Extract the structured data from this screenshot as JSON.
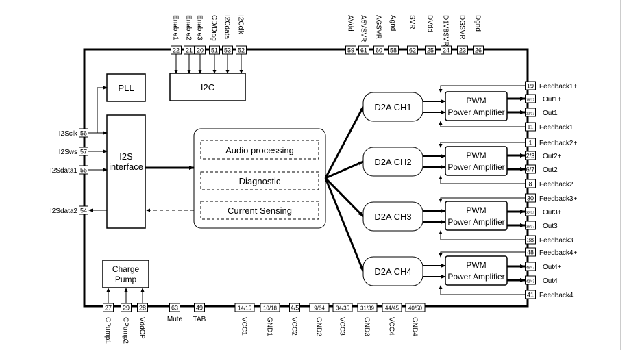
{
  "blocks": {
    "i2c": "I2C",
    "pll": "PLL",
    "i2s": [
      "I2S",
      "interface"
    ],
    "charge_pump": [
      "Charge",
      "Pump"
    ],
    "dsp": [
      "Audio processing",
      "Diagnostic",
      "Current Sensing"
    ],
    "d2a": [
      "D2A CH1",
      "D2A CH2",
      "D2A CH3",
      "D2A CH4"
    ],
    "pwm": [
      "PWM",
      "Power Amplifier"
    ]
  },
  "top_pins": [
    {
      "num": "22",
      "label": "Enable1"
    },
    {
      "num": "21",
      "label": "Enable2"
    },
    {
      "num": "20",
      "label": "Enable3"
    },
    {
      "num": "51",
      "label": "CD/Diag"
    },
    {
      "num": "53",
      "label": "I2Cdata"
    },
    {
      "num": "52",
      "label": "I2Cclk"
    },
    {
      "num": "59",
      "label": "AVdd"
    },
    {
      "num": "61",
      "label": "A5VSVR"
    },
    {
      "num": "60",
      "label": "AGSVR"
    },
    {
      "num": "58",
      "label": "Agnd"
    },
    {
      "num": "62",
      "label": "SVR"
    },
    {
      "num": "25",
      "label": "DVdd"
    },
    {
      "num": "24",
      "label": "D1V8SVR"
    },
    {
      "num": "23",
      "label": "DGSVR"
    },
    {
      "num": "26",
      "label": "Dgnd"
    }
  ],
  "left_pins": [
    {
      "num": "56",
      "label": "I2Sclk"
    },
    {
      "num": "57",
      "label": "I2Sws"
    },
    {
      "num": "55",
      "label": "I2Sdata1"
    },
    {
      "num": "54",
      "label": "I2Sdata2"
    }
  ],
  "right_pins": [
    {
      "num": "19",
      "label": "Feedback1+"
    },
    {
      "num": "16/17",
      "label": "Out1+"
    },
    {
      "num": "12/13",
      "label": "Out1"
    },
    {
      "num": "11",
      "label": "Feedback1"
    },
    {
      "num": "1",
      "label": "Feedback2+"
    },
    {
      "num": "2/3",
      "label": "Out2+"
    },
    {
      "num": "6/7",
      "label": "Out2"
    },
    {
      "num": "8",
      "label": "Feedback2"
    },
    {
      "num": "30",
      "label": "Feedback3+"
    },
    {
      "num": "32/33",
      "label": "Out3+"
    },
    {
      "num": "36/37",
      "label": "Out3"
    },
    {
      "num": "38",
      "label": "Feedback3"
    },
    {
      "num": "48",
      "label": "Feedback4+"
    },
    {
      "num": "46/47",
      "label": "Out4+"
    },
    {
      "num": "42/43",
      "label": "Out4"
    },
    {
      "num": "41",
      "label": "Feedback4"
    }
  ],
  "bottom_pins": [
    {
      "num": "27",
      "label": "CPump1",
      "rot": true
    },
    {
      "num": "29",
      "label": "CPump2",
      "rot": true
    },
    {
      "num": "28",
      "label": "VddCP",
      "rot": true
    },
    {
      "num": "63",
      "label": "Mute",
      "rot": false
    },
    {
      "num": "49",
      "label": "TAB",
      "rot": false
    },
    {
      "num": "14/15",
      "label": "VCC1",
      "rot": true
    },
    {
      "num": "10/18",
      "label": "GND1",
      "rot": true
    },
    {
      "num": "4/5",
      "label": "VCC2",
      "rot": true
    },
    {
      "num": "9/64",
      "label": "GND2",
      "rot": true
    },
    {
      "num": "34/35",
      "label": "VCC3",
      "rot": true
    },
    {
      "num": "31/39",
      "label": "GND3",
      "rot": true
    },
    {
      "num": "44/45",
      "label": "VCC4",
      "rot": true
    },
    {
      "num": "40/50",
      "label": "GND4",
      "rot": true
    }
  ]
}
